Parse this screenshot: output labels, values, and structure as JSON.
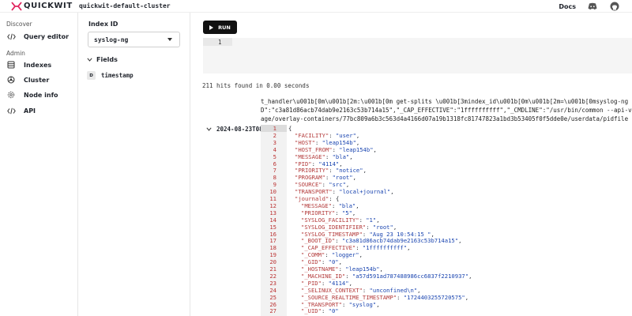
{
  "header": {
    "logo_text": "QUICKWIT",
    "cluster_name": "quickwit-default-cluster",
    "docs_label": "Docs",
    "icons": [
      "discord-icon",
      "github-icon"
    ]
  },
  "sidebar": {
    "discover_label": "Discover",
    "admin_label": "Admin",
    "items": [
      {
        "label": "Query editor",
        "icon": "code-icon"
      },
      {
        "label": "Indexes",
        "icon": "database-icon"
      },
      {
        "label": "Cluster",
        "icon": "cluster-icon"
      },
      {
        "label": "Node info",
        "icon": "gear-icon"
      },
      {
        "label": "API",
        "icon": "code-icon"
      }
    ]
  },
  "index_panel": {
    "title": "Index ID",
    "selected_index": "syslog-ng",
    "fields_label": "Fields",
    "fields": [
      {
        "type": "D",
        "name": "timestamp"
      }
    ]
  },
  "main": {
    "run_label": "RUN",
    "editor_line": "1",
    "query": "",
    "hits_text": "211 hits found in 0.00 seconds",
    "truncated_lines": [
      "t_handler\\u001b[0m\\u001b[2m:\\u001b[0m get-splits \\u001b[3mindex_id\\u001b[0m\\u001b[2m=\\u001b[0msyslog-ng \\u001b[3mlist_",
      "D\":\"c3a81d86acb74dab9e2163c53b714a15\",\"_CAP_EFFECTIVE\":\"1ffffffffff\",\"_CMDLINE\":\"/usr/bin/common --api-version 1 -c 77",
      "age/overlay-containers/77bc809a6b3c563d4a4166d07a19b1318fc81747823a1bd3b53405f0f5dde0e/userdata/pidfile -n festive_tu"
    ],
    "row_timestamp": "2024-08-23T08:",
    "json_lines": [
      {
        "n": "1",
        "indent": 0,
        "key": "",
        "value": "",
        "punct": "{"
      },
      {
        "n": "2",
        "indent": 1,
        "key": "\"FACILITY\"",
        "value": "\"user\"",
        "punct": ","
      },
      {
        "n": "3",
        "indent": 1,
        "key": "\"HOST\"",
        "value": "\"leap154b\"",
        "punct": ","
      },
      {
        "n": "4",
        "indent": 1,
        "key": "\"HOST_FROM\"",
        "value": "\"leap154b\"",
        "punct": ","
      },
      {
        "n": "5",
        "indent": 1,
        "key": "\"MESSAGE\"",
        "value": "\"bla\"",
        "punct": ","
      },
      {
        "n": "6",
        "indent": 1,
        "key": "\"PID\"",
        "value": "\"4114\"",
        "punct": ","
      },
      {
        "n": "7",
        "indent": 1,
        "key": "\"PRIORITY\"",
        "value": "\"notice\"",
        "punct": ","
      },
      {
        "n": "8",
        "indent": 1,
        "key": "\"PROGRAM\"",
        "value": "\"root\"",
        "punct": ","
      },
      {
        "n": "9",
        "indent": 1,
        "key": "\"SOURCE\"",
        "value": "\"src\"",
        "punct": ","
      },
      {
        "n": "10",
        "indent": 1,
        "key": "\"TRANSPORT\"",
        "value": "\"local+journal\"",
        "punct": ","
      },
      {
        "n": "11",
        "indent": 1,
        "key": "\"journald\"",
        "value": "",
        "punct": "{"
      },
      {
        "n": "12",
        "indent": 2,
        "key": "\"MESSAGE\"",
        "value": "\"bla\"",
        "punct": ","
      },
      {
        "n": "13",
        "indent": 2,
        "key": "\"PRIORITY\"",
        "value": "\"5\"",
        "punct": ","
      },
      {
        "n": "14",
        "indent": 2,
        "key": "\"SYSLOG_FACILITY\"",
        "value": "\"1\"",
        "punct": ","
      },
      {
        "n": "15",
        "indent": 2,
        "key": "\"SYSLOG_IDENTIFIER\"",
        "value": "\"root\"",
        "punct": ","
      },
      {
        "n": "16",
        "indent": 2,
        "key": "\"SYSLOG_TIMESTAMP\"",
        "value": "\"Aug 23 10:54:15 \"",
        "punct": ","
      },
      {
        "n": "17",
        "indent": 2,
        "key": "\"_BOOT_ID\"",
        "value": "\"c3a81d86acb74dab9e2163c53b714a15\"",
        "punct": ","
      },
      {
        "n": "18",
        "indent": 2,
        "key": "\"_CAP_EFFECTIVE\"",
        "value": "\"1ffffffffff\"",
        "punct": ","
      },
      {
        "n": "19",
        "indent": 2,
        "key": "\"_COMM\"",
        "value": "\"logger\"",
        "punct": ","
      },
      {
        "n": "20",
        "indent": 2,
        "key": "\"_GID\"",
        "value": "\"0\"",
        "punct": ","
      },
      {
        "n": "21",
        "indent": 2,
        "key": "\"_HOSTNAME\"",
        "value": "\"leap154b\"",
        "punct": ","
      },
      {
        "n": "22",
        "indent": 2,
        "key": "\"_MACHINE_ID\"",
        "value": "\"a57d591ad787488986cc6837f2210937\"",
        "punct": ","
      },
      {
        "n": "23",
        "indent": 2,
        "key": "\"_PID\"",
        "value": "\"4114\"",
        "punct": ","
      },
      {
        "n": "24",
        "indent": 2,
        "key": "\"_SELINUX_CONTEXT\"",
        "value": "\"unconfined\\n\"",
        "punct": ","
      },
      {
        "n": "25",
        "indent": 2,
        "key": "\"_SOURCE_REALTIME_TIMESTAMP\"",
        "value": "\"1724403255720575\"",
        "punct": ","
      },
      {
        "n": "26",
        "indent": 2,
        "key": "\"_TRANSPORT\"",
        "value": "\"syslog\"",
        "punct": ","
      },
      {
        "n": "27",
        "indent": 2,
        "key": "\"_UID\"",
        "value": "\"0\"",
        "punct": ""
      }
    ]
  },
  "colors": {
    "json_key": "#b33a3a",
    "json_string": "#1a45b0",
    "run_button": "#111111"
  }
}
